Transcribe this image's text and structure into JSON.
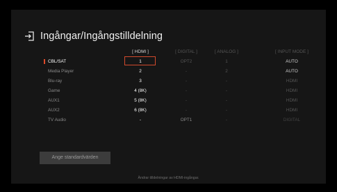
{
  "title": "Ingångar/Ingångstilldelning",
  "columns": {
    "hdmi": "[ HDMI ]",
    "digital": "[ DIGITAL ]",
    "analog": "[ ANALOG ]",
    "input_mode": "[ INPUT MODE ]"
  },
  "rows": [
    {
      "label": "CBL/SAT",
      "hdmi": "1",
      "digital": "OPT2",
      "analog": "1",
      "mode": "AUTO"
    },
    {
      "label": "Media Player",
      "hdmi": "2",
      "digital": "-",
      "analog": "2",
      "mode": "AUTO"
    },
    {
      "label": "Blu-ray",
      "hdmi": "3",
      "digital": "-",
      "analog": "-",
      "mode": "HDMI"
    },
    {
      "label": "Game",
      "hdmi": "4 (8K)",
      "digital": "-",
      "analog": "-",
      "mode": "HDMI"
    },
    {
      "label": "AUX1",
      "hdmi": "5 (8K)",
      "digital": "-",
      "analog": "-",
      "mode": "HDMI"
    },
    {
      "label": "AUX2",
      "hdmi": "6 (8K)",
      "digital": "-",
      "analog": "-",
      "mode": "HDMI"
    },
    {
      "label": "TV Audio",
      "hdmi": "-",
      "digital": "OPT1",
      "analog": "-",
      "mode": "DIGITAL"
    }
  ],
  "default_button": "Ange standardvärden",
  "footer": "Ändrar tilldelningar av HDMI-ingångar.",
  "icons": {
    "title": "input-arrow-icon"
  },
  "colors": {
    "accent": "#e04a2a",
    "background": "#161616"
  }
}
